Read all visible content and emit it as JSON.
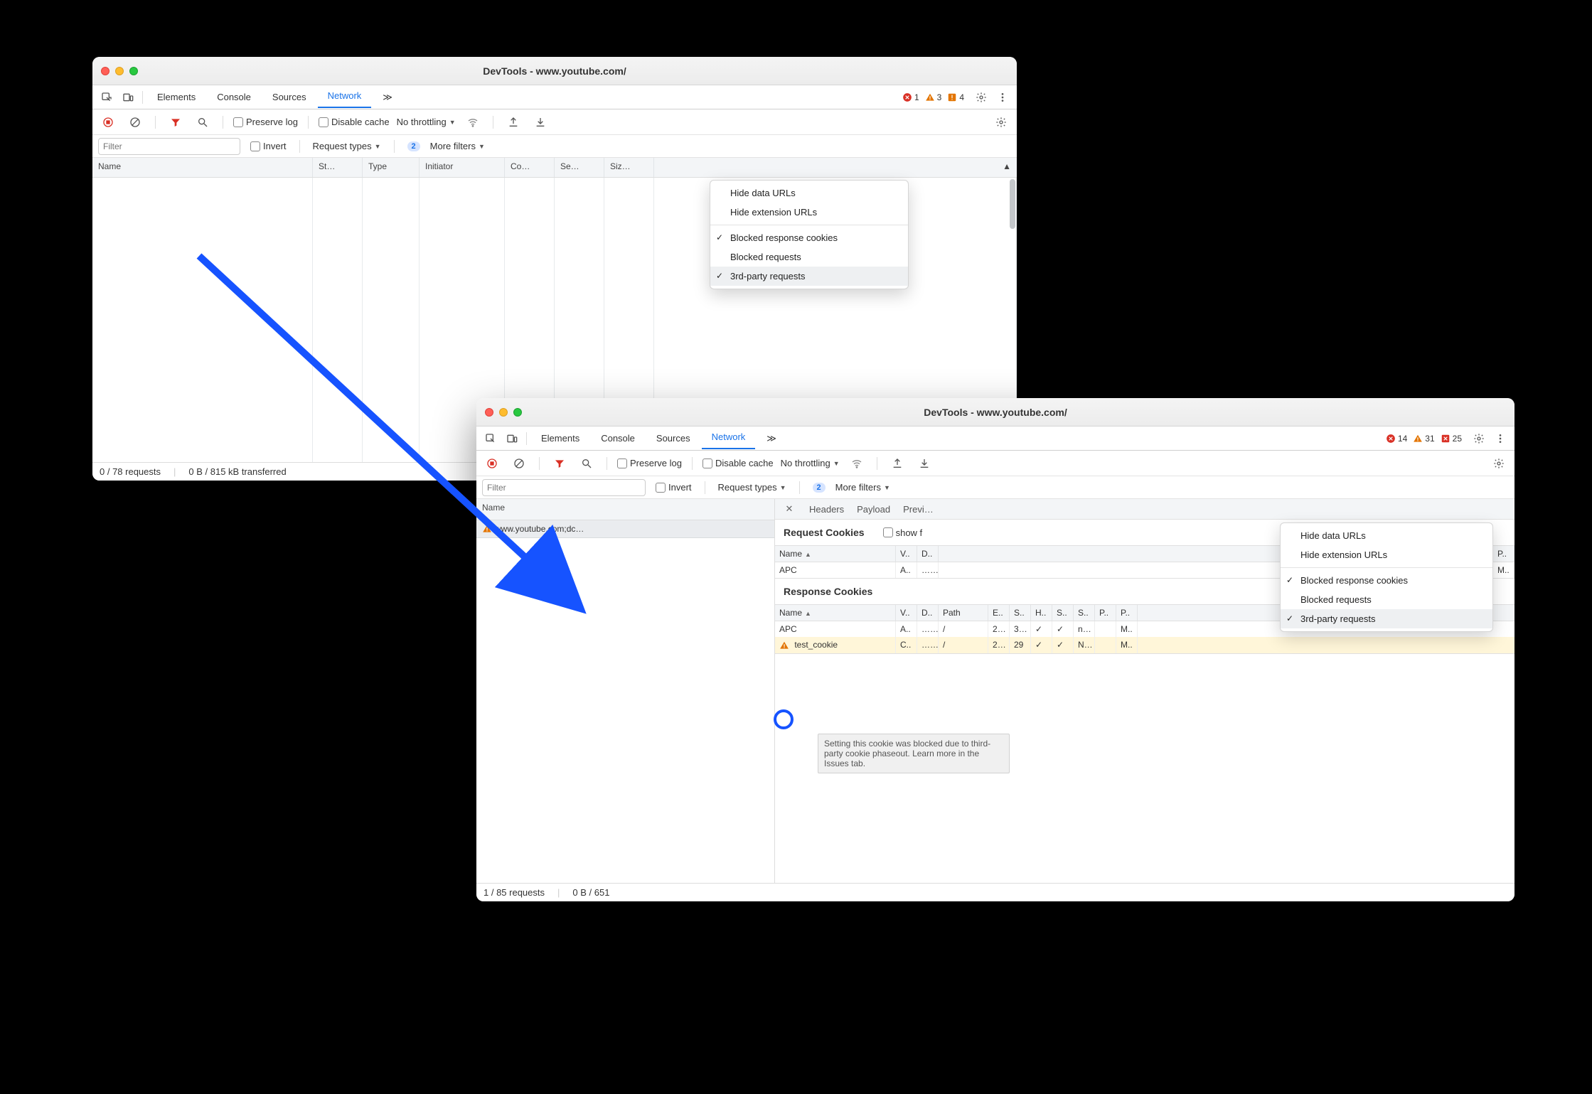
{
  "window1": {
    "title": "DevTools - www.youtube.com/",
    "tabs": [
      "Elements",
      "Console",
      "Sources",
      "Network"
    ],
    "active_tab": "Network",
    "more_tabs_glyph": "≫",
    "error_count": "1",
    "warn_count": "3",
    "info_count": "4",
    "toolbar": {
      "preserve_log": "Preserve log",
      "disable_cache": "Disable cache",
      "throttle": "No throttling"
    },
    "filter": {
      "placeholder": "Filter",
      "invert": "Invert",
      "request_types": "Request types",
      "more_filters": "More filters",
      "filter_count": "2"
    },
    "columns": [
      "Name",
      "St…",
      "Type",
      "Initiator",
      "Co…",
      "Se…",
      "Siz…"
    ],
    "menu": {
      "items": [
        "Hide data URLs",
        "Hide extension URLs",
        "Blocked response cookies",
        "Blocked requests",
        "3rd-party requests"
      ]
    },
    "status": {
      "requests": "0 / 78 requests",
      "transfer": "0 B / 815 kB transferred"
    }
  },
  "window2": {
    "title": "DevTools - www.youtube.com/",
    "tabs": [
      "Elements",
      "Console",
      "Sources",
      "Network"
    ],
    "active_tab": "Network",
    "more_tabs_glyph": "≫",
    "error_count": "14",
    "warn_count": "31",
    "info_count": "25",
    "toolbar": {
      "preserve_log": "Preserve log",
      "disable_cache": "Disable cache",
      "throttle": "No throttling"
    },
    "filter": {
      "placeholder": "Filter",
      "invert": "Invert",
      "request_types": "Request types",
      "more_filters": "More filters",
      "filter_count": "2"
    },
    "name_col": "Name",
    "name_row": "www.youtube.com;dc…",
    "detail_tabs": [
      "Headers",
      "Payload",
      "Previ…"
    ],
    "request_cookies": {
      "title": "Request Cookies",
      "show_filtered": "show f",
      "head": [
        "Name",
        "V..",
        "D.."
      ],
      "head_right": [
        "P.."
      ],
      "row": [
        "APC",
        "A..",
        "….."
      ],
      "row_right": [
        "M.."
      ]
    },
    "response_cookies": {
      "title": "Response Cookies",
      "head": [
        "Name",
        "V..",
        "D..",
        "Path",
        "E..",
        "S..",
        "H..",
        "S..",
        "S..",
        "P..",
        "P.."
      ],
      "rows": [
        {
          "cells": [
            "APC",
            "A..",
            "…..",
            "/",
            "2…",
            "3…",
            "✓",
            "✓",
            "n…",
            "",
            "M.."
          ]
        },
        {
          "cells": [
            "test_cookie",
            "C..",
            "…..",
            "/",
            "2…",
            "29",
            "✓",
            "✓",
            "N…",
            "",
            "M.."
          ],
          "warn": true
        }
      ]
    },
    "tooltip": "Setting this cookie was blocked due to third-party cookie phaseout. Learn more in the Issues tab.",
    "menu": {
      "items": [
        "Hide data URLs",
        "Hide extension URLs",
        "Blocked response cookies",
        "Blocked requests",
        "3rd-party requests"
      ]
    },
    "status": {
      "requests": "1 / 85 requests",
      "transfer": "0 B / 651"
    }
  }
}
